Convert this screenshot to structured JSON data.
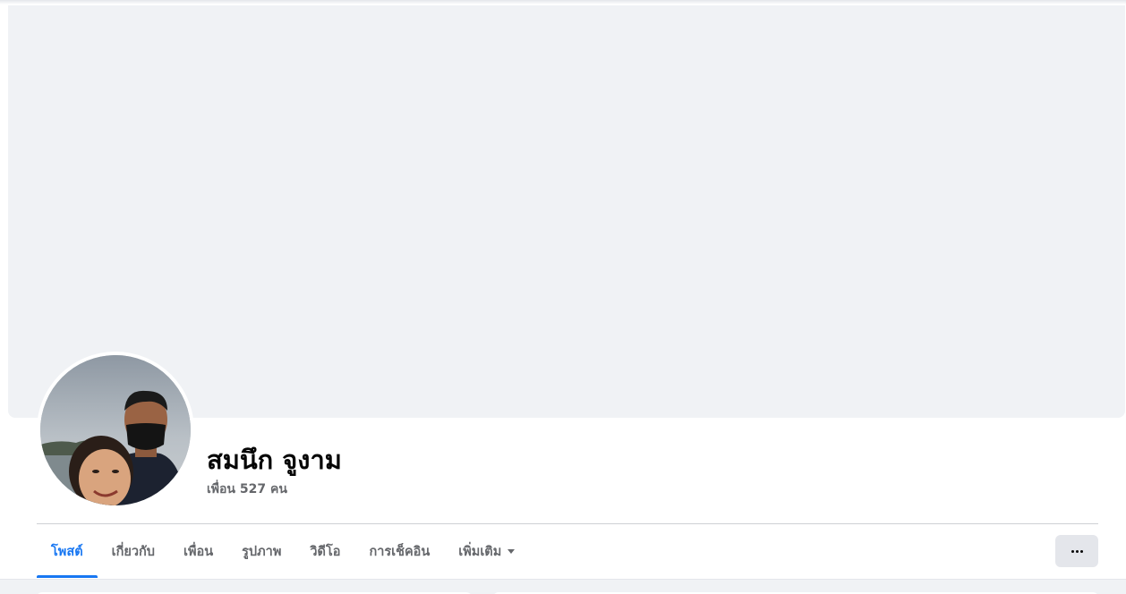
{
  "profile": {
    "name": "สมนึก จูงาม",
    "friends_text": "เพื่อน 527 คน"
  },
  "tabs": [
    {
      "label": "โพสต์",
      "active": true
    },
    {
      "label": "เกี่ยวกับ",
      "active": false
    },
    {
      "label": "เพื่อน",
      "active": false
    },
    {
      "label": "รูปภาพ",
      "active": false
    },
    {
      "label": "วิดีโอ",
      "active": false
    },
    {
      "label": "การเช็คอิน",
      "active": false
    },
    {
      "label": "เพิ่มเติม",
      "active": false,
      "dropdown": true
    }
  ],
  "more_button": {
    "icon": "more-horizontal-icon"
  },
  "colors": {
    "accent": "#1877f2",
    "cover_bg": "#f0f2f5",
    "tab_text": "#65676b",
    "button_bg": "#e4e6eb"
  }
}
